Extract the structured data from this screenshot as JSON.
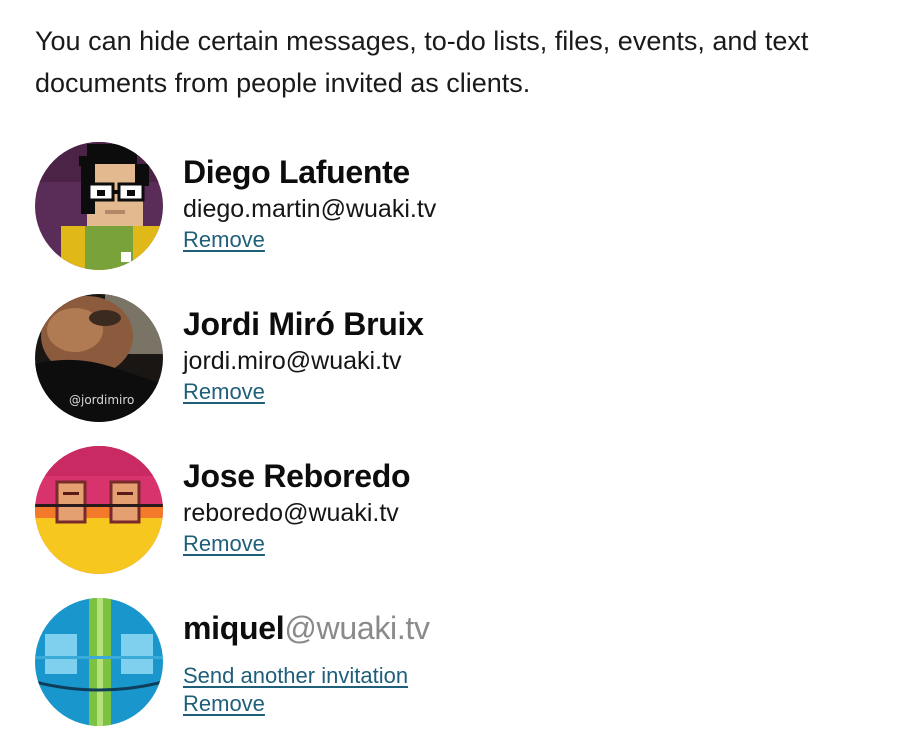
{
  "intro": "You can hide certain messages, to-do lists, files, events, and text documents from people invited as clients.",
  "people": [
    {
      "name": "Diego Lafuente",
      "email": "diego.martin@wuaki.tv",
      "remove_label": "Remove",
      "avatar_icon": "pixel-art-avatar"
    },
    {
      "name": "Jordi Miró Bruix",
      "email": "jordi.miro@wuaki.tv",
      "remove_label": "Remove",
      "avatar_icon": "photo-avatar",
      "avatar_text": "@jordimiro"
    },
    {
      "name": "Jose Reboredo",
      "email": "reboredo@wuaki.tv",
      "remove_label": "Remove",
      "avatar_icon": "glasses-avatar"
    },
    {
      "name_user": "miquel",
      "name_domain": "@wuaki.tv",
      "resend_label": "Send another invitation",
      "remove_label": "Remove",
      "avatar_icon": "abstract-blue-avatar"
    }
  ],
  "colors": {
    "link": "#1f5f7a",
    "domain_gray": "#8a8a8a"
  }
}
